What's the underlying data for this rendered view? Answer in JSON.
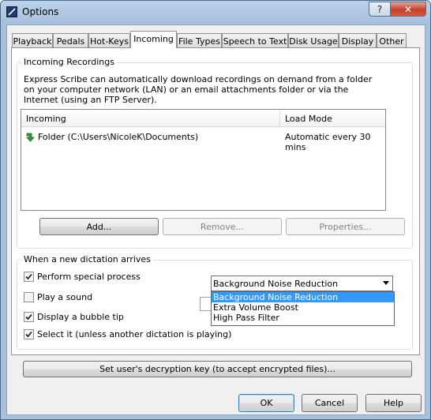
{
  "window": {
    "title": "Options",
    "help_glyph": "?",
    "close_glyph": "✕"
  },
  "tabs": [
    {
      "label": "Playback"
    },
    {
      "label": "Pedals"
    },
    {
      "label": "Hot-Keys"
    },
    {
      "label": "Incoming"
    },
    {
      "label": "File Types"
    },
    {
      "label": "Speech to Text"
    },
    {
      "label": "Disk Usage"
    },
    {
      "label": "Display"
    },
    {
      "label": "Other"
    }
  ],
  "active_tab": "Incoming",
  "incoming_recordings": {
    "group_label": "Incoming Recordings",
    "description": "Express Scribe can automatically download recordings on demand from a folder on your computer network (LAN) or an email attachments folder or via the Internet (using an FTP Server).",
    "columns": [
      "Incoming",
      "Load Mode"
    ],
    "rows": [
      {
        "icon": "green-download-arrow-icon",
        "incoming": "Folder (C:\\Users\\NicoleK\\Documents)",
        "load_mode": "Automatic every 30 mins"
      }
    ],
    "buttons": {
      "add": "Add...",
      "remove": "Remove...",
      "properties": "Properties..."
    }
  },
  "new_dictation": {
    "group_label": "When a new dictation arrives",
    "checkboxes": [
      {
        "label": "Perform special process",
        "checked": true
      },
      {
        "label": "Play a sound",
        "checked": false
      },
      {
        "label": "Display a bubble tip",
        "checked": true
      },
      {
        "label": "Select it (unless another dictation is playing)",
        "checked": true
      }
    ],
    "process_select": {
      "value": "Background Noise Reduction",
      "options": [
        "Background Noise Reduction",
        "Extra Volume Boost",
        "High Pass Filter"
      ],
      "highlighted": "Background Noise Reduction"
    }
  },
  "decryption_button": "Set user's decryption key (to accept encrypted files)...",
  "footer": {
    "ok": "OK",
    "cancel": "Cancel",
    "help": "Help"
  },
  "colors": {
    "accent": "#3399ff",
    "arrow_green": "#2f9a2f",
    "titlebar": "#a9c0db"
  }
}
